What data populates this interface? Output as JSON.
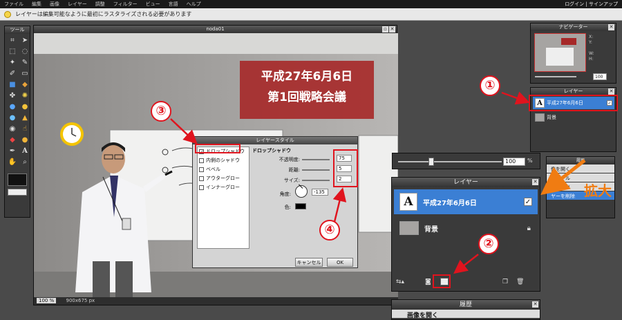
{
  "menu": {
    "items": [
      "ファイル",
      "編集",
      "画像",
      "レイヤー",
      "調整",
      "フィルター",
      "ビュー",
      "言語",
      "ヘルプ"
    ],
    "account": "ログイン | サインアップ"
  },
  "notice": "レイヤーは編集可能なように最初にラスタライズされる必要があります",
  "tools": {
    "title": "ツール"
  },
  "document": {
    "title": "noda01",
    "zoom": "100 %",
    "size": "900x675 px",
    "banner_line1": "平成27年6月6日",
    "banner_line2": "第1回戦略会議"
  },
  "layer_style": {
    "title": "レイヤースタイル",
    "styles": [
      {
        "label": "ドロップシャドウ",
        "checked": true
      },
      {
        "label": "内側のシャドウ",
        "checked": false
      },
      {
        "label": "ベベル",
        "checked": false
      },
      {
        "label": "アウターグロー",
        "checked": false
      },
      {
        "label": "インナーグロー",
        "checked": false
      }
    ],
    "section": "ドロップシャドウ",
    "opacity_label": "不透明度:",
    "opacity": "75",
    "distance_label": "距離:",
    "distance": "5",
    "size_label": "サイズ:",
    "size": "2",
    "angle_label": "角度:",
    "angle": "-135",
    "color_label": "色:",
    "cancel": "キャンセル",
    "ok": "OK"
  },
  "navigator": {
    "title": "ナビゲーター",
    "zoom": "100",
    "x_label": "X:",
    "y_label": "Y:",
    "w_label": "W:",
    "h_label": "H:"
  },
  "layers_small": {
    "title": "レイヤー",
    "layer1": "平成27年6月6日",
    "layer2": "背景"
  },
  "layers_big": {
    "title": "レイヤー",
    "layer1": "平成27年6月6日",
    "layer2": "背景"
  },
  "history": {
    "title": "履歴",
    "item": "画像を開く"
  },
  "history_partial": {
    "title": "履歴",
    "items": [
      "像を開く",
      "規ツール",
      "いレイヤ",
      "ヤーを削除"
    ]
  },
  "zoom_mid": "100",
  "annotations": {
    "n1": "①",
    "n2": "②",
    "n3": "③",
    "n4": "④",
    "enlarge": "拡大"
  },
  "colors": {
    "accent_red": "#e0141e",
    "selection_blue": "#3b7fd4",
    "enlarge_orange": "#f07c12"
  }
}
